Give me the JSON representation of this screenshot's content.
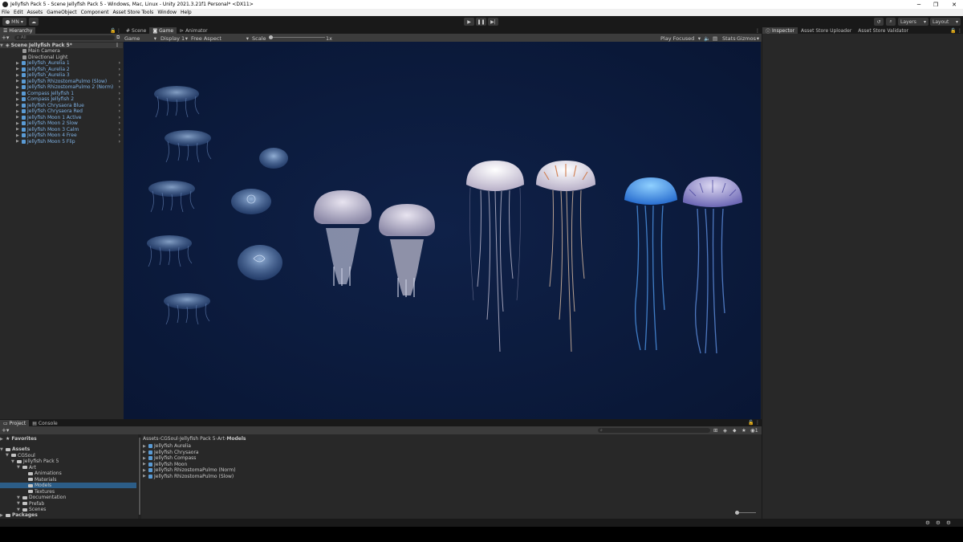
{
  "window": {
    "title": "Jellyfish Pack 5 - Scene Jellyfish Pack 5 - Windows, Mac, Linux - Unity 2021.3.21f1 Personal* <DX11>",
    "controls": [
      "─",
      "❐",
      "✕"
    ]
  },
  "menu": [
    "File",
    "Edit",
    "Assets",
    "GameObject",
    "Component",
    "Asset Store Tools",
    "Window",
    "Help"
  ],
  "toolbar": {
    "account": "MN",
    "layers_label": "Layers",
    "layout_label": "Layout"
  },
  "hierarchy": {
    "tab": "Hierarchy",
    "search_placeholder": "All",
    "scene": "Scene Jellyfish Pack 5*",
    "items": [
      {
        "label": "Main Camera",
        "prefab": false
      },
      {
        "label": "Directional Light",
        "prefab": false
      },
      {
        "label": "Jellyfish_Aurelia 1",
        "prefab": true
      },
      {
        "label": "Jellyfish_Aurelia 2",
        "prefab": true
      },
      {
        "label": "Jellyfish_Aurelia 3",
        "prefab": true
      },
      {
        "label": "Jellyfish RhizostomaPulmo (Slow)",
        "prefab": true
      },
      {
        "label": "Jellyfish RhizostomaPulmo 2 (Norm)",
        "prefab": true
      },
      {
        "label": "Compass Jellyfish 1",
        "prefab": true
      },
      {
        "label": "Compass Jellyfish 2",
        "prefab": true
      },
      {
        "label": "Jellyfish Chrysaora Blue",
        "prefab": true
      },
      {
        "label": "Jellyfish Chrysaora Red",
        "prefab": true
      },
      {
        "label": "Jellyfish Moon 1 Active",
        "prefab": true
      },
      {
        "label": "Jellyfish Moon 2 Slow",
        "prefab": true
      },
      {
        "label": "Jellyfish Moon 3 Calm",
        "prefab": true
      },
      {
        "label": "Jellyfish Moon 4 Free",
        "prefab": true
      },
      {
        "label": "Jellyfish Moon 5 Flip",
        "prefab": true
      }
    ]
  },
  "center": {
    "tabs": [
      "Scene",
      "Game",
      "Animator"
    ],
    "active_tab": "Game",
    "game_toolbar": {
      "mode": "Game",
      "display": "Display 1",
      "aspect": "Free Aspect",
      "scale_label": "Scale",
      "scale_value": "1x",
      "play_focused": "Play Focused",
      "stats": "Stats",
      "gizmos": "Gizmos"
    }
  },
  "inspector": {
    "tabs": [
      "Inspector",
      "Asset Store Uploader",
      "Asset Store Validator"
    ]
  },
  "project": {
    "tabs": [
      "Project",
      "Console"
    ],
    "favorites": "Favorites",
    "tree": [
      {
        "label": "Assets",
        "depth": 0,
        "bold": true
      },
      {
        "label": "CGSoul",
        "depth": 1
      },
      {
        "label": "Jellyfish Pack 5",
        "depth": 2
      },
      {
        "label": "Art",
        "depth": 3
      },
      {
        "label": "Animations",
        "depth": 4
      },
      {
        "label": "Materials",
        "depth": 4
      },
      {
        "label": "Models",
        "depth": 4,
        "selected": true
      },
      {
        "label": "Textures",
        "depth": 4
      },
      {
        "label": "Documentation",
        "depth": 3
      },
      {
        "label": "Prefab",
        "depth": 3
      },
      {
        "label": "Scenes",
        "depth": 3
      }
    ],
    "packages": "Packages",
    "breadcrumb": [
      "Assets",
      "CGSoul",
      "Jellyfish Pack 5",
      "Art",
      "Models"
    ],
    "files": [
      "Jellyfish Aurelia",
      "Jellyfish Chrysaora",
      "Jellyfish Compass",
      "Jellyfish Moon",
      "Jellyfish RhizostomaPulmo (Norm)",
      "Jellyfish RhizostomaPulmo (Slow)"
    ],
    "count": "1"
  },
  "colors": {
    "viewport_bg": "#0b1a3a",
    "panel_bg": "#282828",
    "selection": "#2c5d87",
    "prefab_text": "#7fb2e5"
  }
}
